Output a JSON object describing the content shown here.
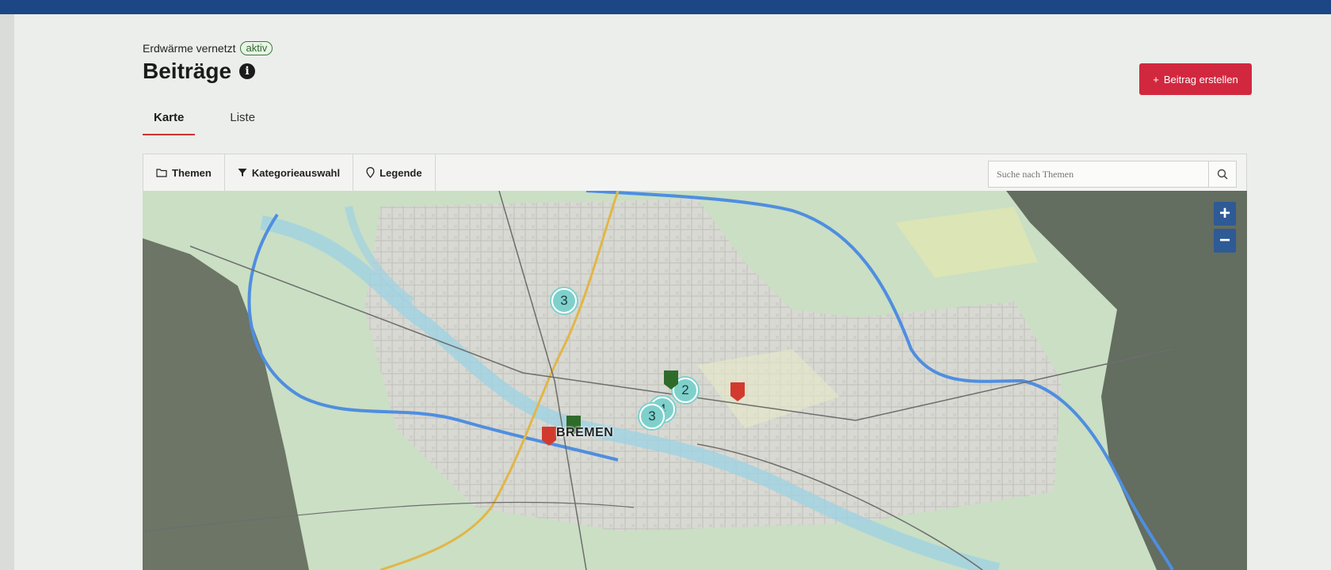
{
  "header": {
    "project_name": "Erdwärme vernetzt",
    "status_badge": "aktiv",
    "page_title": "Beiträge",
    "create_button": "Beitrag erstellen"
  },
  "tabs": [
    {
      "label": "Karte",
      "active": true
    },
    {
      "label": "Liste",
      "active": false
    }
  ],
  "toolbar": {
    "themes": "Themen",
    "categories": "Kategorieauswahl",
    "legend": "Legende",
    "search_placeholder": "Suche nach Themen"
  },
  "map": {
    "city_label": "BREMEN",
    "zoom_in": "+",
    "zoom_out": "−",
    "clusters": [
      {
        "count": "3"
      },
      {
        "count": "2"
      },
      {
        "count": "4"
      },
      {
        "count": "3"
      }
    ],
    "pin_colors": {
      "green": "#2e6b2a",
      "red": "#d23a2e"
    }
  },
  "colors": {
    "accent": "#d2283f",
    "topbar": "#1c4784",
    "cluster": "#7fd0cb"
  }
}
